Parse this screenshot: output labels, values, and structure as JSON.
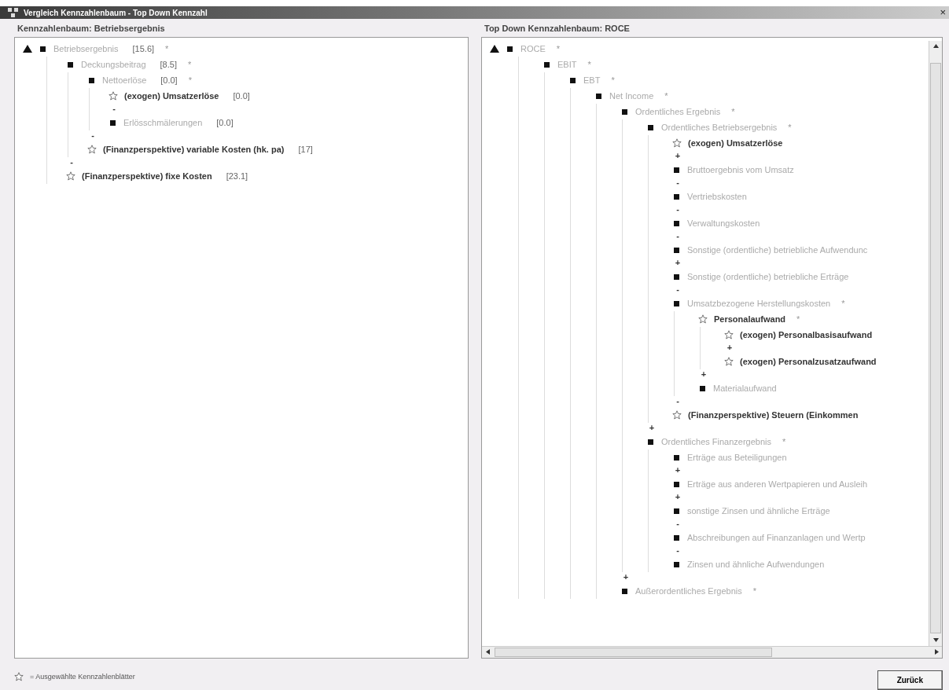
{
  "window": {
    "title": "Vergleich Kennzahlenbaum - Top Down Kennzahl",
    "close": "×"
  },
  "left_panel": {
    "title": "Kennzahlenbaum: Betriebsergebnis",
    "tree": [
      {
        "kind": "square",
        "label": "Betriebsergebnis",
        "value": "[15.6]",
        "suffix": "*",
        "children": [
          {
            "kind": "square",
            "label": "Deckungsbeitrag",
            "value": "[8.5]",
            "suffix": "*",
            "children": [
              {
                "kind": "square",
                "label": "Nettoerlöse",
                "value": "[0.0]",
                "suffix": "*",
                "children": [
                  {
                    "kind": "star",
                    "label": "(exogen) Umsatzerlöse",
                    "value": "[0.0]"
                  },
                  {
                    "kind": "square",
                    "operator": "-",
                    "label": "Erlösschmälerungen",
                    "value": "[0.0]"
                  }
                ]
              },
              {
                "kind": "star",
                "operator": "-",
                "label": "(Finanzperspektive) variable Kosten (hk. pa)",
                "value": "[17]"
              }
            ]
          },
          {
            "kind": "star",
            "operator": "-",
            "label": "(Finanzperspektive) fixe Kosten",
            "value": "[23.1]"
          }
        ]
      }
    ]
  },
  "right_panel": {
    "title": "Top Down Kennzahlenbaum: ROCE",
    "tree": [
      {
        "kind": "square",
        "label": "ROCE",
        "suffix": "*",
        "children": [
          {
            "kind": "square",
            "label": "EBIT",
            "suffix": "*",
            "children": [
              {
                "kind": "square",
                "label": "EBT",
                "suffix": "*",
                "children": [
                  {
                    "kind": "square",
                    "label": "Net Income",
                    "suffix": "*",
                    "children": [
                      {
                        "kind": "square",
                        "label": "Ordentliches Ergebnis",
                        "suffix": "*",
                        "children": [
                          {
                            "kind": "square",
                            "label": "Ordentliches Betriebsergebnis",
                            "suffix": "*",
                            "children": [
                              {
                                "kind": "star",
                                "label": "(exogen) Umsatzerlöse"
                              },
                              {
                                "kind": "square",
                                "operator": "+",
                                "label": "Bruttoergebnis vom Umsatz"
                              },
                              {
                                "kind": "square",
                                "operator": "-",
                                "label": "Vertriebskosten"
                              },
                              {
                                "kind": "square",
                                "operator": "-",
                                "label": "Verwaltungskosten"
                              },
                              {
                                "kind": "square",
                                "operator": "-",
                                "label": "Sonstige (ordentliche) betriebliche Aufwendunc"
                              },
                              {
                                "kind": "square",
                                "operator": "+",
                                "label": "Sonstige (ordentliche) betriebliche Erträge"
                              },
                              {
                                "kind": "square",
                                "operator": "-",
                                "label": "Umsatzbezogene Herstellungskosten",
                                "suffix": "*",
                                "children": [
                                  {
                                    "kind": "star",
                                    "label": "Personalaufwand",
                                    "suffix": "*",
                                    "children": [
                                      {
                                        "kind": "star",
                                        "label": "(exogen) Personalbasisaufwand"
                                      },
                                      {
                                        "kind": "star",
                                        "operator": "+",
                                        "label": "(exogen) Personalzusatzaufwand"
                                      }
                                    ]
                                  },
                                  {
                                    "kind": "square",
                                    "operator": "+",
                                    "label": "Materialaufwand"
                                  }
                                ]
                              },
                              {
                                "kind": "star",
                                "operator": "-",
                                "label": "(Finanzperspektive) Steuern (Einkommen"
                              }
                            ]
                          },
                          {
                            "kind": "square",
                            "operator": "+",
                            "label": "Ordentliches Finanzergebnis",
                            "suffix": "*",
                            "children": [
                              {
                                "kind": "square",
                                "label": "Erträge aus Beteiligungen"
                              },
                              {
                                "kind": "square",
                                "operator": "+",
                                "label": "Erträge aus anderen Wertpapieren und Ausleih"
                              },
                              {
                                "kind": "square",
                                "operator": "+",
                                "label": "sonstige Zinsen und ähnliche Erträge"
                              },
                              {
                                "kind": "square",
                                "operator": "-",
                                "label": "Abschreibungen auf Finanzanlagen und Wertp"
                              },
                              {
                                "kind": "square",
                                "operator": "-",
                                "label": "Zinsen und ähnliche Aufwendungen"
                              }
                            ]
                          }
                        ]
                      },
                      {
                        "kind": "square",
                        "operator": "+",
                        "label": "Außerordentliches Ergebnis",
                        "suffix": "*"
                      }
                    ]
                  }
                ]
              }
            ]
          }
        ]
      }
    ]
  },
  "legend": {
    "text": "= Ausgewählte Kennzahlenblätter"
  },
  "buttons": [
    "Zurück"
  ]
}
